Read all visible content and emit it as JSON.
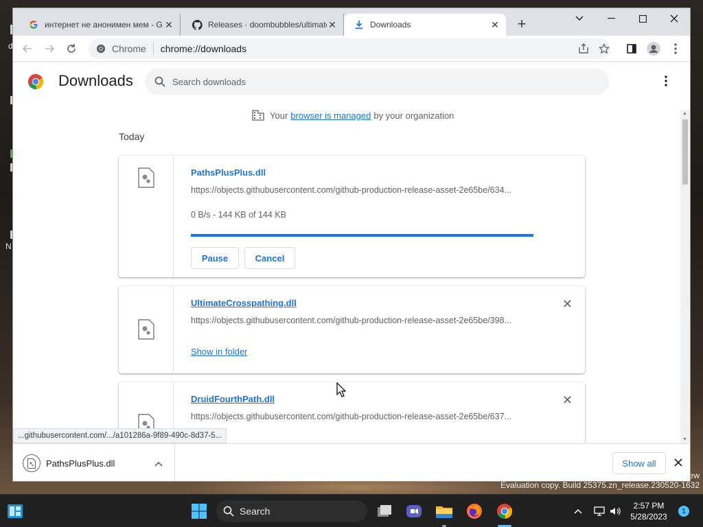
{
  "browser": {
    "tabs": [
      {
        "title": "интернет не анонимен мем - G",
        "favicon": "google-icon",
        "active": false
      },
      {
        "title": "Releases · doombubbles/ultimate",
        "favicon": "github-icon",
        "active": false
      },
      {
        "title": "Downloads",
        "favicon": "download-icon",
        "active": true
      }
    ],
    "omnibox": {
      "site_label": "Chrome",
      "url": "chrome://downloads"
    }
  },
  "downloads_page": {
    "title": "Downloads",
    "search_placeholder": "Search downloads",
    "managed_notice": {
      "prefix": "Your",
      "link": "browser is managed",
      "suffix": "by your organization"
    },
    "section": "Today",
    "items": [
      {
        "filename": "PathsPlusPlus.dll",
        "url": "https://objects.githubusercontent.com/github-production-release-asset-2e65be/634...",
        "status": "0 B/s - 144 KB of 144 KB",
        "progress": 1.0,
        "buttons": [
          "Pause",
          "Cancel"
        ]
      },
      {
        "filename": "UltimateCrosspathing.dll",
        "url": "https://objects.githubusercontent.com/github-production-release-asset-2e65be/398...",
        "action": "Show in folder"
      },
      {
        "filename": "DruidFourthPath.dll",
        "url": "https://objects.githubusercontent.com/github-production-release-asset-2e65be/637..."
      }
    ]
  },
  "status_bubble": "...githubusercontent.com/.../a101286a-9f89-490c-8d37-5...",
  "download_shelf": {
    "item": "PathsPlusPlus.dll",
    "show_all": "Show all"
  },
  "desktop": {
    "watermark_line1": "ew",
    "watermark_line2": "Evaluation copy. Build 25375.zn_release.230520-1632"
  },
  "taskbar": {
    "search_label": "Search",
    "time": "2:57 PM",
    "date": "5/28/2023",
    "notification_count": "1"
  },
  "colors": {
    "accent": "#1a73e8",
    "taskbar": "#202020",
    "notification": "#4cc2ff"
  }
}
